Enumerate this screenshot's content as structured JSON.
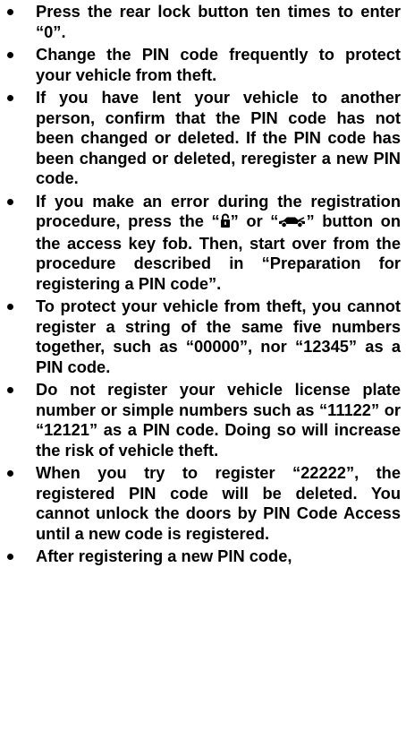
{
  "bullets": [
    {
      "text": "Press the rear lock button ten times to enter “0”."
    },
    {
      "text": "Change the PIN code frequently to protect your vehicle from theft."
    },
    {
      "text": "If you have lent your vehicle to another person, confirm that the PIN code has not been changed or deleted. If the PIN code has been changed or deleted, reregister a new PIN code."
    },
    {
      "before_icon1": "If you make an error during the registration procedure, press the “",
      "icon1": "unlock-icon",
      "between_icons": "” or “",
      "icon2": "car-trunk-icon",
      "after_icon2": "” button on the access key fob. Then, start over from the procedure described in “Preparation for registering a PIN code”."
    },
    {
      "text": "To protect your vehicle from theft, you cannot register a string of the same five numbers together, such as “00000”, nor “12345” as a PIN code."
    },
    {
      "text": "Do not register your vehicle license plate number or simple numbers such as “11122” or “12121” as a PIN code. Doing so will increase the risk of vehicle theft."
    },
    {
      "text": "When you try to register “22222”, the registered PIN code will be deleted. You cannot unlock the doors by PIN Code Access until a new code is registered."
    },
    {
      "text": "After registering a new PIN code,"
    }
  ]
}
